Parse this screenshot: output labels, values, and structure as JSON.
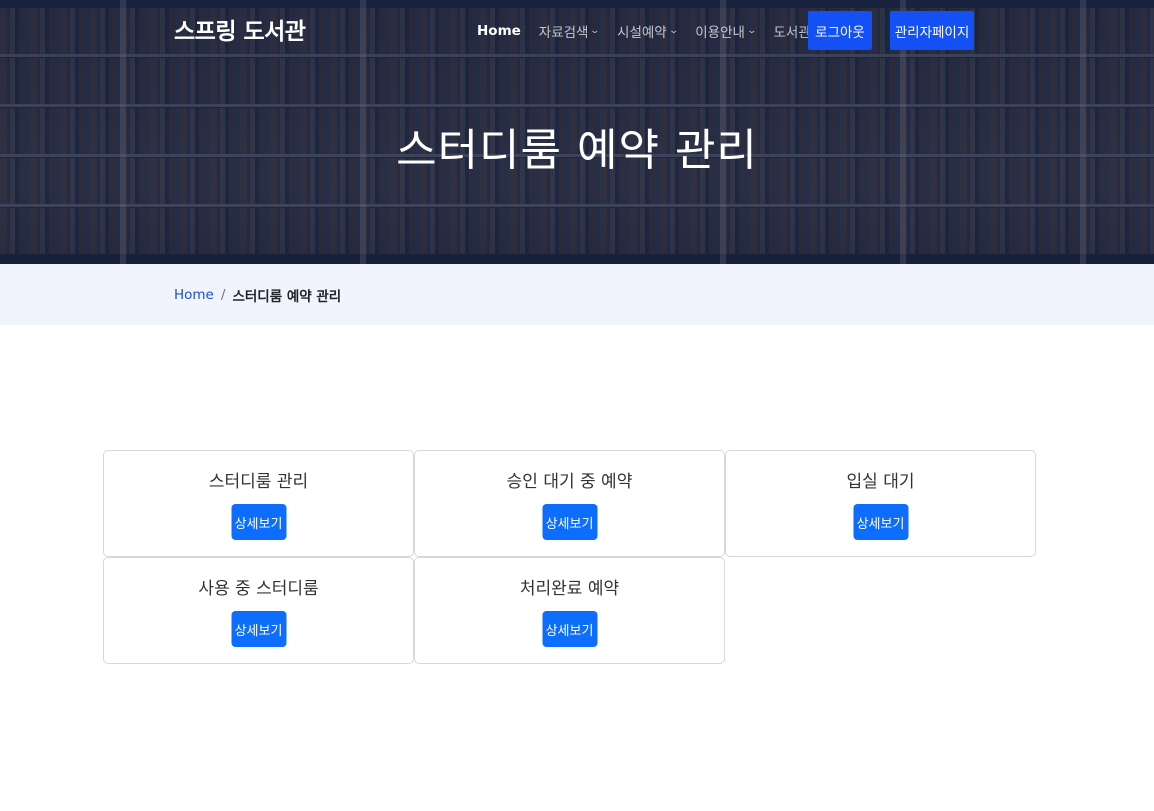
{
  "header": {
    "brand": "스프링 도서관",
    "nav": [
      {
        "label": "Home",
        "active": true,
        "dropdown": false
      },
      {
        "label": "자료검색",
        "active": false,
        "dropdown": true
      },
      {
        "label": "시설예약",
        "active": false,
        "dropdown": true
      },
      {
        "label": "이용안내",
        "active": false,
        "dropdown": true
      },
      {
        "label": "도서관소식",
        "active": false,
        "dropdown": true
      }
    ],
    "logout_label": "로그아웃",
    "admin_label": "관리자페이지",
    "chevron": "⌄"
  },
  "hero": {
    "title": "스터디룸 예약 관리"
  },
  "breadcrumb": {
    "home": "Home",
    "separator": "/",
    "current": "스터디룸 예약 관리"
  },
  "cards": [
    {
      "title": "스터디룸 관리",
      "button": "상세보기"
    },
    {
      "title": "승인 대기 중 예약",
      "button": "상세보기"
    },
    {
      "title": "입실 대기",
      "button": "상세보기"
    },
    {
      "title": "사용 중 스터디룸",
      "button": "상세보기"
    },
    {
      "title": "처리완료 예약",
      "button": "상세보기"
    }
  ],
  "colors": {
    "primary_button": "#0d6efd",
    "nav_button": "#1451f4",
    "breadcrumb_bg": "#f1f4fc",
    "link": "#1a4fd8"
  }
}
